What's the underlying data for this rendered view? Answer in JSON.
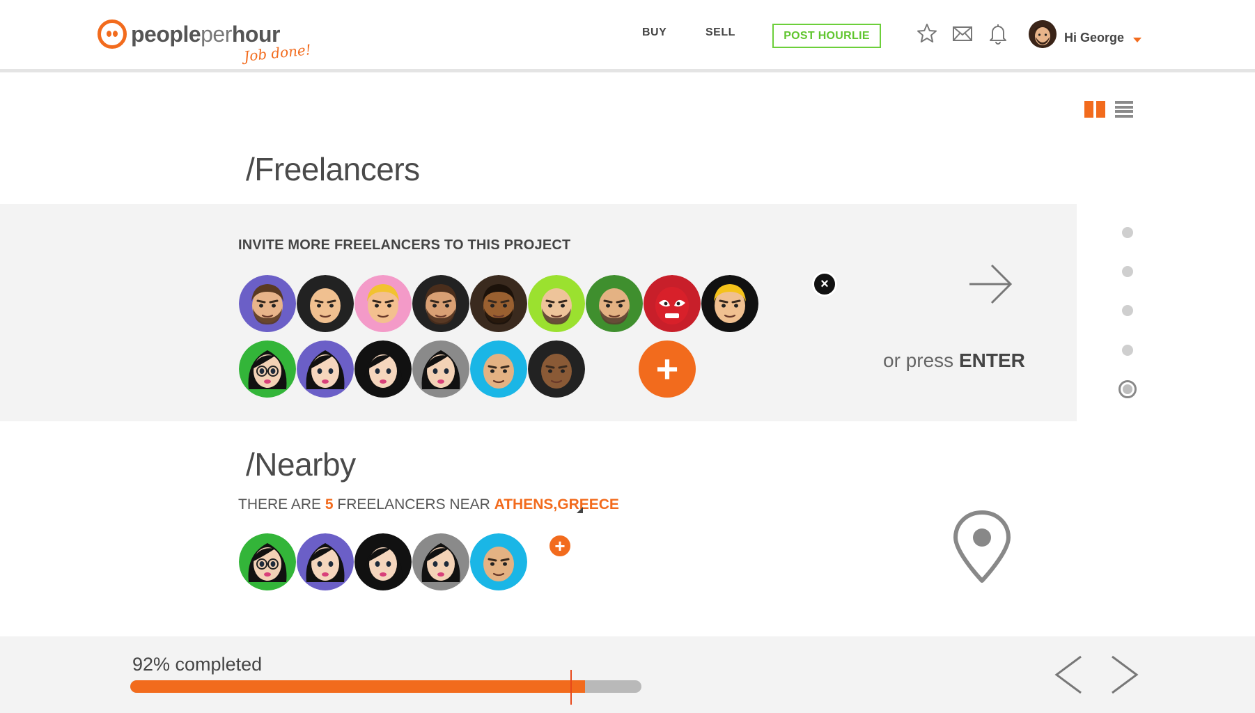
{
  "header": {
    "logo_text_bold": "people",
    "logo_text_light": "per",
    "logo_text_bold2": "hour",
    "tagline": "Job done!",
    "nav_buy": "BUY",
    "nav_sell": "SELL",
    "post_button": "POST HOURLIE",
    "greeting": "Hi George",
    "icons": [
      "star-icon",
      "mail-icon",
      "bell-icon"
    ]
  },
  "view_toggle": {
    "options": [
      "grid-view",
      "list-view"
    ],
    "active": "grid-view"
  },
  "freelancers": {
    "heading": "/Freelancers",
    "invite_title": "INVITE MORE FREELANCERS TO THIS PROJECT",
    "press_prefix": "or press ",
    "press_key": "ENTER",
    "avatars_row1": [
      {
        "ring": "#6b5fc7",
        "skin": "#e8b48a",
        "hair": "#5a3a22",
        "beard": true
      },
      {
        "ring": "#222222",
        "skin": "#f0c090",
        "hair": "none",
        "beard": false
      },
      {
        "ring": "#f39ac8",
        "skin": "#f3c08f",
        "hair": "#f2c230",
        "beard": false
      },
      {
        "ring": "#222222",
        "skin": "#d9a074",
        "hair": "#4a2e1c",
        "beard": true
      },
      {
        "ring": "#3a2a1e",
        "skin": "#9a6030",
        "hair": "#1c120a",
        "beard": true
      },
      {
        "ring": "#9be12f",
        "skin": "#eec49a",
        "hair": "none",
        "beard": true
      },
      {
        "ring": "#3f8f2e",
        "skin": "#e4b283",
        "hair": "none",
        "beard": true
      },
      {
        "ring": "#c81f2a",
        "skin": "#d8202a",
        "hair": "mask",
        "beard": false
      },
      {
        "ring": "#111111",
        "skin": "#f0c090",
        "hair": "#f4c21a",
        "beard": false
      }
    ],
    "avatars_row2": [
      {
        "ring": "#33b539",
        "skin": "#f3d2b6",
        "hair": "#111111",
        "glasses": true
      },
      {
        "ring": "#6b5fc7",
        "skin": "#f5d6bd",
        "hair": "#111111",
        "glasses": false
      },
      {
        "ring": "#111111",
        "skin": "#f5d6bd",
        "hair": "#111111",
        "glasses": false
      },
      {
        "ring": "#8a8a8a",
        "skin": "#f3d2b6",
        "hair": "#111111",
        "glasses": false
      },
      {
        "ring": "#1ab6e6",
        "skin": "#e4b283",
        "hair": "none",
        "glasses": false
      },
      {
        "ring": "#222222",
        "skin": "#8a5a36",
        "hair": "none",
        "glasses": false
      }
    ]
  },
  "nearby": {
    "heading": "/Nearby",
    "prefix": "THERE ARE ",
    "count": "5",
    "middle": " FREELANCERS NEAR ",
    "location": "ATHENS,GREECE",
    "avatars": [
      {
        "ring": "#33b539",
        "skin": "#f3d2b6",
        "hair": "#111111",
        "glasses": true
      },
      {
        "ring": "#6b5fc7",
        "skin": "#f5d6bd",
        "hair": "#111111",
        "glasses": false
      },
      {
        "ring": "#111111",
        "skin": "#f5d6bd",
        "hair": "#111111",
        "glasses": false
      },
      {
        "ring": "#8a8a8a",
        "skin": "#f3d2b6",
        "hair": "#111111",
        "glasses": false
      },
      {
        "ring": "#1ab6e6",
        "skin": "#e4b283",
        "hair": "none",
        "glasses": false
      }
    ]
  },
  "side_steps": {
    "count": 5,
    "active_index": 4
  },
  "progress": {
    "label": "92% completed",
    "fraction": 0.89
  },
  "colors": {
    "accent": "#f26b1d",
    "green": "#5fc52e"
  }
}
